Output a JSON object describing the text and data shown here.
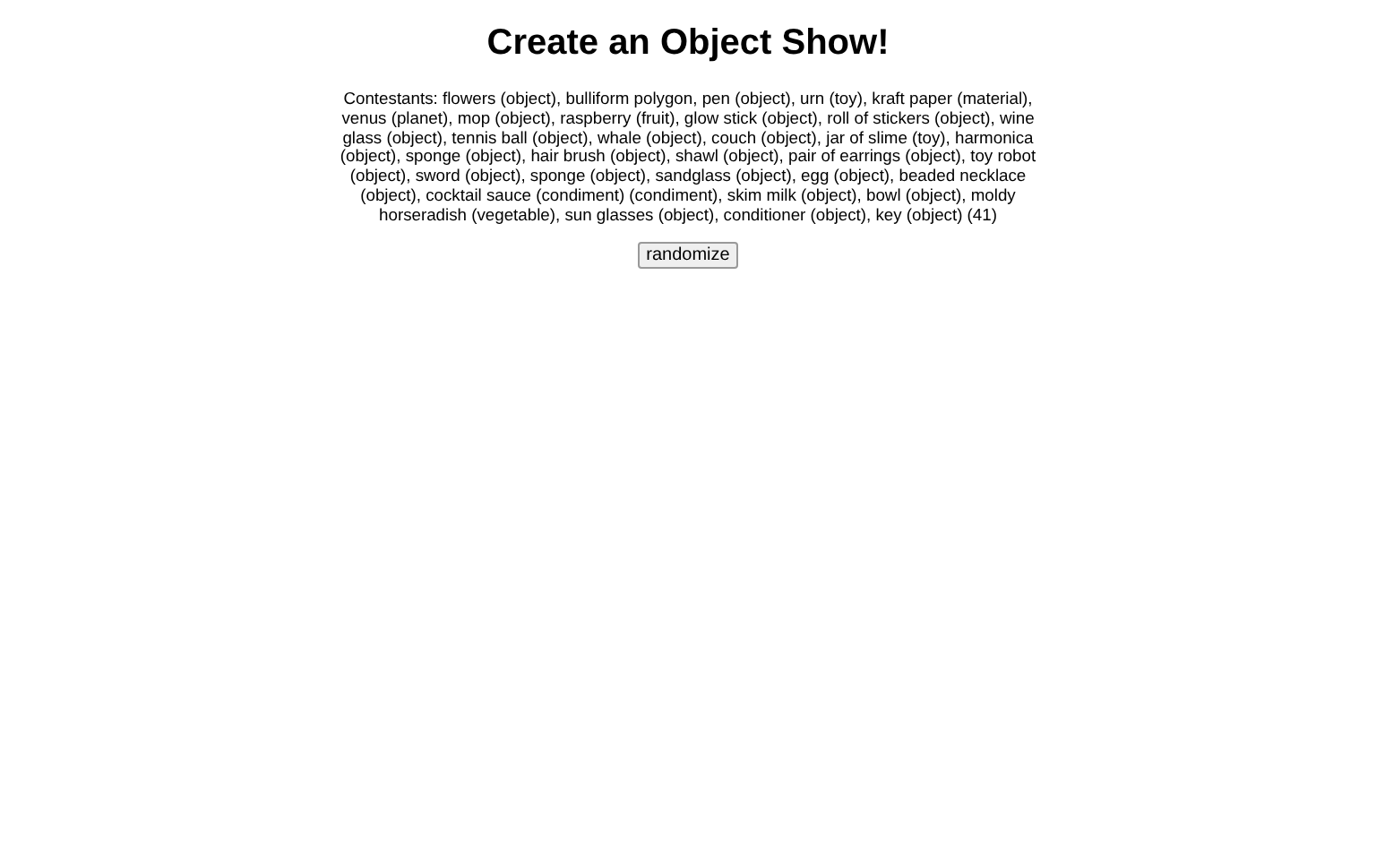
{
  "title": "Create an Object Show!",
  "contestants": "Contestants: flowers (object), bulliform polygon, pen (object), urn (toy), kraft paper (material), venus (planet), mop (object), raspberry (fruit), glow stick (object), roll of stickers (object), wine glass (object), tennis ball (object), whale (object), couch (object), jar of slime (toy), harmonica (object), sponge (object), hair brush (object), shawl (object), pair of earrings (object), toy robot (object), sword (object), sponge (object), sandglass (object), egg (object), beaded necklace (object), cocktail sauce (condiment) (condiment), skim milk (object), bowl (object), moldy horseradish (vegetable), sun glasses (object), conditioner (object), key (object) (41)",
  "button": "randomize"
}
